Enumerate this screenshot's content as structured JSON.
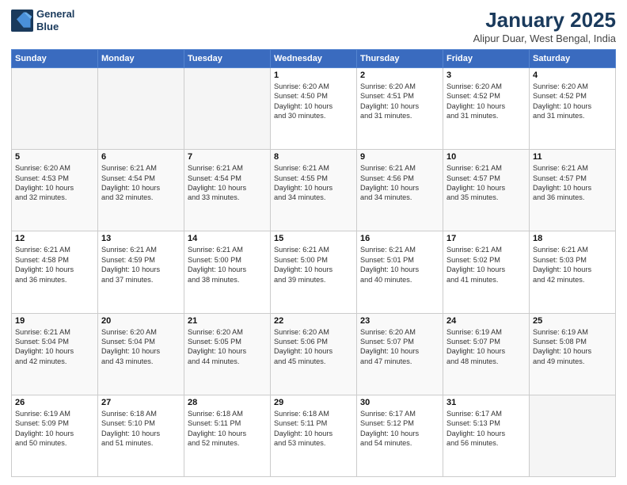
{
  "header": {
    "logo_line1": "General",
    "logo_line2": "Blue",
    "title": "January 2025",
    "subtitle": "Alipur Duar, West Bengal, India"
  },
  "days_of_week": [
    "Sunday",
    "Monday",
    "Tuesday",
    "Wednesday",
    "Thursday",
    "Friday",
    "Saturday"
  ],
  "weeks": [
    [
      {
        "day": "",
        "info": ""
      },
      {
        "day": "",
        "info": ""
      },
      {
        "day": "",
        "info": ""
      },
      {
        "day": "1",
        "info": "Sunrise: 6:20 AM\nSunset: 4:50 PM\nDaylight: 10 hours\nand 30 minutes."
      },
      {
        "day": "2",
        "info": "Sunrise: 6:20 AM\nSunset: 4:51 PM\nDaylight: 10 hours\nand 31 minutes."
      },
      {
        "day": "3",
        "info": "Sunrise: 6:20 AM\nSunset: 4:52 PM\nDaylight: 10 hours\nand 31 minutes."
      },
      {
        "day": "4",
        "info": "Sunrise: 6:20 AM\nSunset: 4:52 PM\nDaylight: 10 hours\nand 31 minutes."
      }
    ],
    [
      {
        "day": "5",
        "info": "Sunrise: 6:20 AM\nSunset: 4:53 PM\nDaylight: 10 hours\nand 32 minutes."
      },
      {
        "day": "6",
        "info": "Sunrise: 6:21 AM\nSunset: 4:54 PM\nDaylight: 10 hours\nand 32 minutes."
      },
      {
        "day": "7",
        "info": "Sunrise: 6:21 AM\nSunset: 4:54 PM\nDaylight: 10 hours\nand 33 minutes."
      },
      {
        "day": "8",
        "info": "Sunrise: 6:21 AM\nSunset: 4:55 PM\nDaylight: 10 hours\nand 34 minutes."
      },
      {
        "day": "9",
        "info": "Sunrise: 6:21 AM\nSunset: 4:56 PM\nDaylight: 10 hours\nand 34 minutes."
      },
      {
        "day": "10",
        "info": "Sunrise: 6:21 AM\nSunset: 4:57 PM\nDaylight: 10 hours\nand 35 minutes."
      },
      {
        "day": "11",
        "info": "Sunrise: 6:21 AM\nSunset: 4:57 PM\nDaylight: 10 hours\nand 36 minutes."
      }
    ],
    [
      {
        "day": "12",
        "info": "Sunrise: 6:21 AM\nSunset: 4:58 PM\nDaylight: 10 hours\nand 36 minutes."
      },
      {
        "day": "13",
        "info": "Sunrise: 6:21 AM\nSunset: 4:59 PM\nDaylight: 10 hours\nand 37 minutes."
      },
      {
        "day": "14",
        "info": "Sunrise: 6:21 AM\nSunset: 5:00 PM\nDaylight: 10 hours\nand 38 minutes."
      },
      {
        "day": "15",
        "info": "Sunrise: 6:21 AM\nSunset: 5:00 PM\nDaylight: 10 hours\nand 39 minutes."
      },
      {
        "day": "16",
        "info": "Sunrise: 6:21 AM\nSunset: 5:01 PM\nDaylight: 10 hours\nand 40 minutes."
      },
      {
        "day": "17",
        "info": "Sunrise: 6:21 AM\nSunset: 5:02 PM\nDaylight: 10 hours\nand 41 minutes."
      },
      {
        "day": "18",
        "info": "Sunrise: 6:21 AM\nSunset: 5:03 PM\nDaylight: 10 hours\nand 42 minutes."
      }
    ],
    [
      {
        "day": "19",
        "info": "Sunrise: 6:21 AM\nSunset: 5:04 PM\nDaylight: 10 hours\nand 42 minutes."
      },
      {
        "day": "20",
        "info": "Sunrise: 6:20 AM\nSunset: 5:04 PM\nDaylight: 10 hours\nand 43 minutes."
      },
      {
        "day": "21",
        "info": "Sunrise: 6:20 AM\nSunset: 5:05 PM\nDaylight: 10 hours\nand 44 minutes."
      },
      {
        "day": "22",
        "info": "Sunrise: 6:20 AM\nSunset: 5:06 PM\nDaylight: 10 hours\nand 45 minutes."
      },
      {
        "day": "23",
        "info": "Sunrise: 6:20 AM\nSunset: 5:07 PM\nDaylight: 10 hours\nand 47 minutes."
      },
      {
        "day": "24",
        "info": "Sunrise: 6:19 AM\nSunset: 5:07 PM\nDaylight: 10 hours\nand 48 minutes."
      },
      {
        "day": "25",
        "info": "Sunrise: 6:19 AM\nSunset: 5:08 PM\nDaylight: 10 hours\nand 49 minutes."
      }
    ],
    [
      {
        "day": "26",
        "info": "Sunrise: 6:19 AM\nSunset: 5:09 PM\nDaylight: 10 hours\nand 50 minutes."
      },
      {
        "day": "27",
        "info": "Sunrise: 6:18 AM\nSunset: 5:10 PM\nDaylight: 10 hours\nand 51 minutes."
      },
      {
        "day": "28",
        "info": "Sunrise: 6:18 AM\nSunset: 5:11 PM\nDaylight: 10 hours\nand 52 minutes."
      },
      {
        "day": "29",
        "info": "Sunrise: 6:18 AM\nSunset: 5:11 PM\nDaylight: 10 hours\nand 53 minutes."
      },
      {
        "day": "30",
        "info": "Sunrise: 6:17 AM\nSunset: 5:12 PM\nDaylight: 10 hours\nand 54 minutes."
      },
      {
        "day": "31",
        "info": "Sunrise: 6:17 AM\nSunset: 5:13 PM\nDaylight: 10 hours\nand 56 minutes."
      },
      {
        "day": "",
        "info": ""
      }
    ]
  ]
}
